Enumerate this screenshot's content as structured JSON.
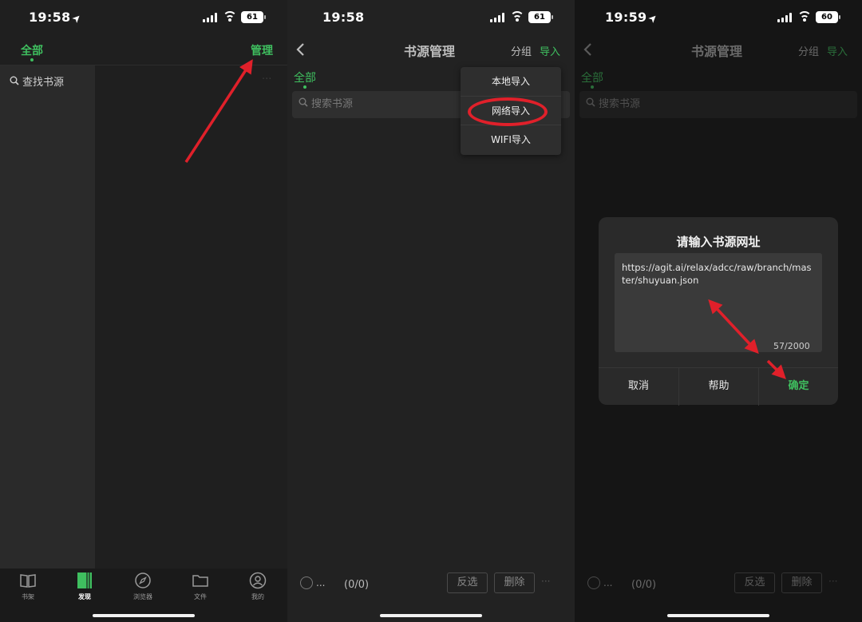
{
  "accent_color": "#3fbf5f",
  "arrow_color": "#e0202a",
  "panel1": {
    "status": {
      "time": "19:58",
      "battery": "61"
    },
    "tab_all": "全部",
    "manage": "管理",
    "search_label": "查找书源",
    "more": "···",
    "nav": [
      {
        "label": "书架",
        "icon": "book-icon"
      },
      {
        "label": "发现",
        "icon": "discover-icon"
      },
      {
        "label": "浏览器",
        "icon": "compass-icon"
      },
      {
        "label": "文件",
        "icon": "folder-icon"
      },
      {
        "label": "我的",
        "icon": "user-icon"
      }
    ]
  },
  "panel2": {
    "status": {
      "time": "19:58",
      "battery": "61"
    },
    "title": "书源管理",
    "group": "分组",
    "import": "导入",
    "tab_all": "全部",
    "search_placeholder": "搜索书源",
    "menu": [
      "本地导入",
      "网络导入",
      "WIFI导入"
    ],
    "footer": {
      "ellipsis": "...",
      "count": "(0/0)",
      "invert": "反选",
      "delete": "删除",
      "more": "···"
    }
  },
  "panel3": {
    "status": {
      "time": "19:59",
      "battery": "60"
    },
    "title": "书源管理",
    "group": "分组",
    "import": "导入",
    "tab_all": "全部",
    "search_placeholder": "搜索书源",
    "dialog": {
      "title": "请输入书源网址",
      "url": "https://agit.ai/relax/adcc/raw/branch/master/shuyuan.json",
      "count": "57/2000",
      "cancel": "取消",
      "help": "帮助",
      "ok": "确定"
    },
    "footer": {
      "ellipsis": "...",
      "count": "(0/0)",
      "invert": "反选",
      "delete": "删除",
      "more": "···"
    }
  }
}
